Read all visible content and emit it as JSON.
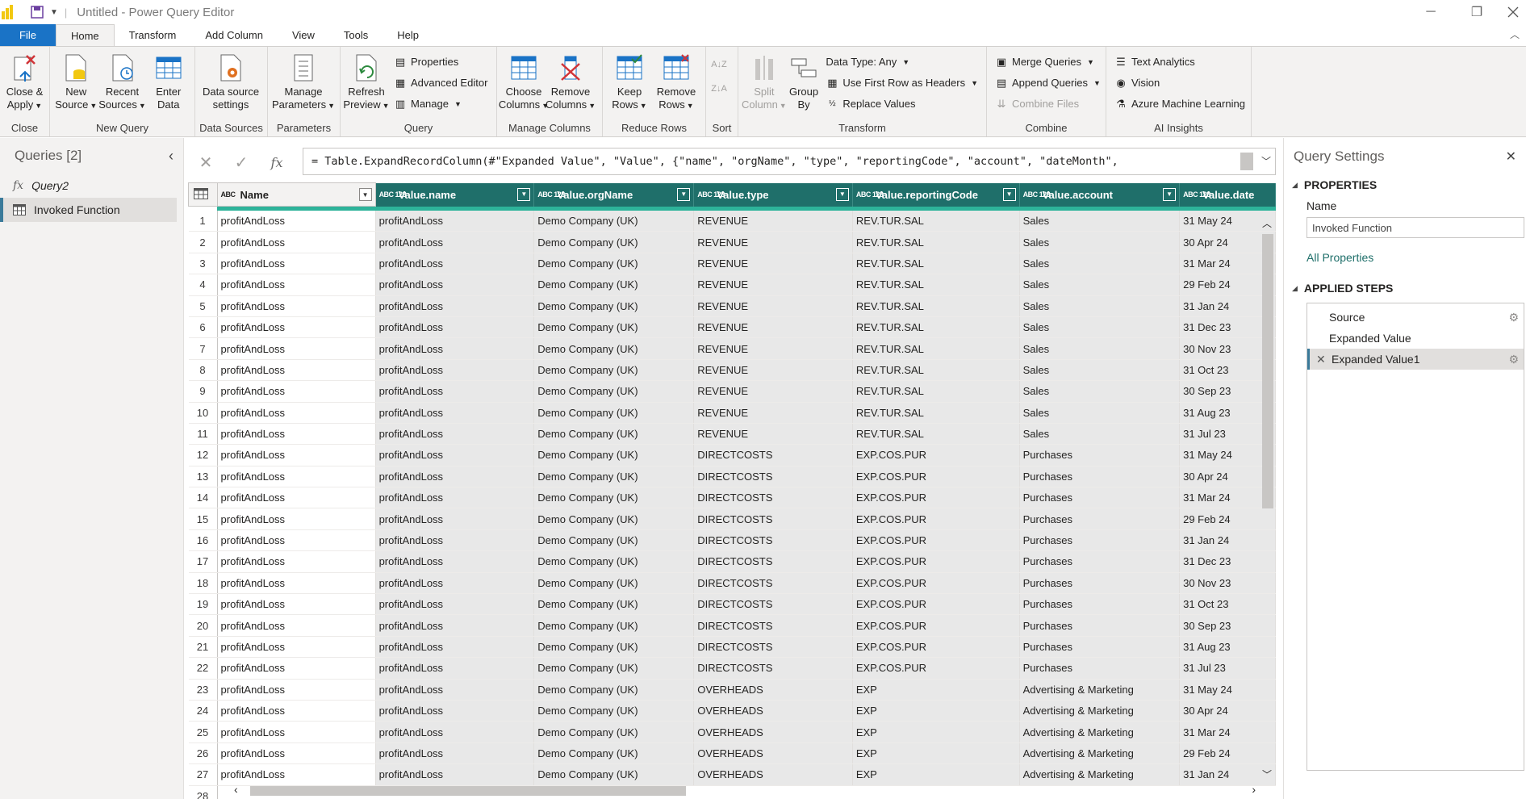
{
  "window": {
    "title": "Untitled - Power Query Editor",
    "controls": {
      "minimize": "─",
      "maximize": "❐"
    }
  },
  "tabs": [
    "File",
    "Home",
    "Transform",
    "Add Column",
    "View",
    "Tools",
    "Help"
  ],
  "ribbon": {
    "groups": [
      {
        "label": "Close",
        "buttons": [
          {
            "l1": "Close &",
            "l2": "Apply",
            "caret": true
          }
        ]
      },
      {
        "label": "New Query",
        "buttons": [
          {
            "l1": "New",
            "l2": "Source",
            "caret": true
          },
          {
            "l1": "Recent",
            "l2": "Sources",
            "caret": true
          },
          {
            "l1": "Enter",
            "l2": "Data",
            "caret": false
          }
        ]
      },
      {
        "label": "Data Sources",
        "buttons": [
          {
            "l1": "Data source",
            "l2": "settings",
            "caret": false
          }
        ]
      },
      {
        "label": "Parameters",
        "buttons": [
          {
            "l1": "Manage",
            "l2": "Parameters",
            "caret": true
          }
        ]
      },
      {
        "label": "Query",
        "refresh": {
          "l1": "Refresh",
          "l2": "Preview"
        },
        "small": [
          "Properties",
          "Advanced Editor",
          "Manage"
        ]
      },
      {
        "label": "Manage Columns",
        "buttons": [
          {
            "l1": "Choose",
            "l2": "Columns",
            "caret": true
          },
          {
            "l1": "Remove",
            "l2": "Columns",
            "caret": true
          }
        ]
      },
      {
        "label": "Reduce Rows",
        "buttons": [
          {
            "l1": "Keep",
            "l2": "Rows",
            "caret": true
          },
          {
            "l1": "Remove",
            "l2": "Rows",
            "caret": true
          }
        ]
      },
      {
        "label": "Sort"
      },
      {
        "label": "Transform",
        "split": {
          "l1": "Split",
          "l2": "Column"
        },
        "group_by": {
          "l1": "Group",
          "l2": "By"
        },
        "small": [
          "Data Type: Any",
          "Use First Row as Headers",
          "Replace Values"
        ]
      },
      {
        "label": "Combine",
        "small": [
          "Merge Queries",
          "Append Queries",
          "Combine Files"
        ]
      },
      {
        "label": "AI Insights",
        "small": [
          "Text Analytics",
          "Vision",
          "Azure Machine Learning"
        ]
      }
    ]
  },
  "queries": {
    "header": "Queries [2]",
    "items": [
      {
        "name": "Query2",
        "icon": "fx"
      },
      {
        "name": "Invoked Function",
        "icon": "table"
      }
    ]
  },
  "formula": "= Table.ExpandRecordColumn(#\"Expanded Value\", \"Value\", {\"name\", \"orgName\", \"type\", \"reportingCode\", \"account\", \"dateMonth\",",
  "grid": {
    "columns": [
      {
        "name": "Name",
        "type": "ABC"
      },
      {
        "name": "Value.name",
        "type": "ABC 123"
      },
      {
        "name": "Value.orgName",
        "type": "ABC 123"
      },
      {
        "name": "Value.type",
        "type": "ABC 123"
      },
      {
        "name": "Value.reportingCode",
        "type": "ABC 123"
      },
      {
        "name": "Value.account",
        "type": "ABC 123"
      },
      {
        "name": "Value.date",
        "type": "ABC 123"
      }
    ],
    "rows": [
      [
        "profitAndLoss",
        "profitAndLoss",
        "Demo Company (UK)",
        "REVENUE",
        "REV.TUR.SAL",
        "Sales",
        "31 May 24"
      ],
      [
        "profitAndLoss",
        "profitAndLoss",
        "Demo Company (UK)",
        "REVENUE",
        "REV.TUR.SAL",
        "Sales",
        "30 Apr 24"
      ],
      [
        "profitAndLoss",
        "profitAndLoss",
        "Demo Company (UK)",
        "REVENUE",
        "REV.TUR.SAL",
        "Sales",
        "31 Mar 24"
      ],
      [
        "profitAndLoss",
        "profitAndLoss",
        "Demo Company (UK)",
        "REVENUE",
        "REV.TUR.SAL",
        "Sales",
        "29 Feb 24"
      ],
      [
        "profitAndLoss",
        "profitAndLoss",
        "Demo Company (UK)",
        "REVENUE",
        "REV.TUR.SAL",
        "Sales",
        "31 Jan 24"
      ],
      [
        "profitAndLoss",
        "profitAndLoss",
        "Demo Company (UK)",
        "REVENUE",
        "REV.TUR.SAL",
        "Sales",
        "31 Dec 23"
      ],
      [
        "profitAndLoss",
        "profitAndLoss",
        "Demo Company (UK)",
        "REVENUE",
        "REV.TUR.SAL",
        "Sales",
        "30 Nov 23"
      ],
      [
        "profitAndLoss",
        "profitAndLoss",
        "Demo Company (UK)",
        "REVENUE",
        "REV.TUR.SAL",
        "Sales",
        "31 Oct 23"
      ],
      [
        "profitAndLoss",
        "profitAndLoss",
        "Demo Company (UK)",
        "REVENUE",
        "REV.TUR.SAL",
        "Sales",
        "30 Sep 23"
      ],
      [
        "profitAndLoss",
        "profitAndLoss",
        "Demo Company (UK)",
        "REVENUE",
        "REV.TUR.SAL",
        "Sales",
        "31 Aug 23"
      ],
      [
        "profitAndLoss",
        "profitAndLoss",
        "Demo Company (UK)",
        "REVENUE",
        "REV.TUR.SAL",
        "Sales",
        "31 Jul 23"
      ],
      [
        "profitAndLoss",
        "profitAndLoss",
        "Demo Company (UK)",
        "DIRECTCOSTS",
        "EXP.COS.PUR",
        "Purchases",
        "31 May 24"
      ],
      [
        "profitAndLoss",
        "profitAndLoss",
        "Demo Company (UK)",
        "DIRECTCOSTS",
        "EXP.COS.PUR",
        "Purchases",
        "30 Apr 24"
      ],
      [
        "profitAndLoss",
        "profitAndLoss",
        "Demo Company (UK)",
        "DIRECTCOSTS",
        "EXP.COS.PUR",
        "Purchases",
        "31 Mar 24"
      ],
      [
        "profitAndLoss",
        "profitAndLoss",
        "Demo Company (UK)",
        "DIRECTCOSTS",
        "EXP.COS.PUR",
        "Purchases",
        "29 Feb 24"
      ],
      [
        "profitAndLoss",
        "profitAndLoss",
        "Demo Company (UK)",
        "DIRECTCOSTS",
        "EXP.COS.PUR",
        "Purchases",
        "31 Jan 24"
      ],
      [
        "profitAndLoss",
        "profitAndLoss",
        "Demo Company (UK)",
        "DIRECTCOSTS",
        "EXP.COS.PUR",
        "Purchases",
        "31 Dec 23"
      ],
      [
        "profitAndLoss",
        "profitAndLoss",
        "Demo Company (UK)",
        "DIRECTCOSTS",
        "EXP.COS.PUR",
        "Purchases",
        "30 Nov 23"
      ],
      [
        "profitAndLoss",
        "profitAndLoss",
        "Demo Company (UK)",
        "DIRECTCOSTS",
        "EXP.COS.PUR",
        "Purchases",
        "31 Oct 23"
      ],
      [
        "profitAndLoss",
        "profitAndLoss",
        "Demo Company (UK)",
        "DIRECTCOSTS",
        "EXP.COS.PUR",
        "Purchases",
        "30 Sep 23"
      ],
      [
        "profitAndLoss",
        "profitAndLoss",
        "Demo Company (UK)",
        "DIRECTCOSTS",
        "EXP.COS.PUR",
        "Purchases",
        "31 Aug 23"
      ],
      [
        "profitAndLoss",
        "profitAndLoss",
        "Demo Company (UK)",
        "DIRECTCOSTS",
        "EXP.COS.PUR",
        "Purchases",
        "31 Jul 23"
      ],
      [
        "profitAndLoss",
        "profitAndLoss",
        "Demo Company (UK)",
        "OVERHEADS",
        "EXP",
        "Advertising & Marketing",
        "31 May 24"
      ],
      [
        "profitAndLoss",
        "profitAndLoss",
        "Demo Company (UK)",
        "OVERHEADS",
        "EXP",
        "Advertising & Marketing",
        "30 Apr 24"
      ],
      [
        "profitAndLoss",
        "profitAndLoss",
        "Demo Company (UK)",
        "OVERHEADS",
        "EXP",
        "Advertising & Marketing",
        "31 Mar 24"
      ],
      [
        "profitAndLoss",
        "profitAndLoss",
        "Demo Company (UK)",
        "OVERHEADS",
        "EXP",
        "Advertising & Marketing",
        "29 Feb 24"
      ],
      [
        "profitAndLoss",
        "profitAndLoss",
        "Demo Company (UK)",
        "OVERHEADS",
        "EXP",
        "Advertising & Marketing",
        "31 Jan 24"
      ]
    ],
    "extra_row_number": "28"
  },
  "settings": {
    "title": "Query Settings",
    "properties_header": "PROPERTIES",
    "name_label": "Name",
    "name_value": "Invoked Function",
    "all_properties": "All Properties",
    "steps_header": "APPLIED STEPS",
    "steps": [
      "Source",
      "Expanded Value",
      "Expanded Value1"
    ],
    "selected_step": 2
  },
  "colors": {
    "accent": "#1a73c6",
    "header_teal": "#1f6f6a",
    "quality_bar": "#2db39a"
  }
}
